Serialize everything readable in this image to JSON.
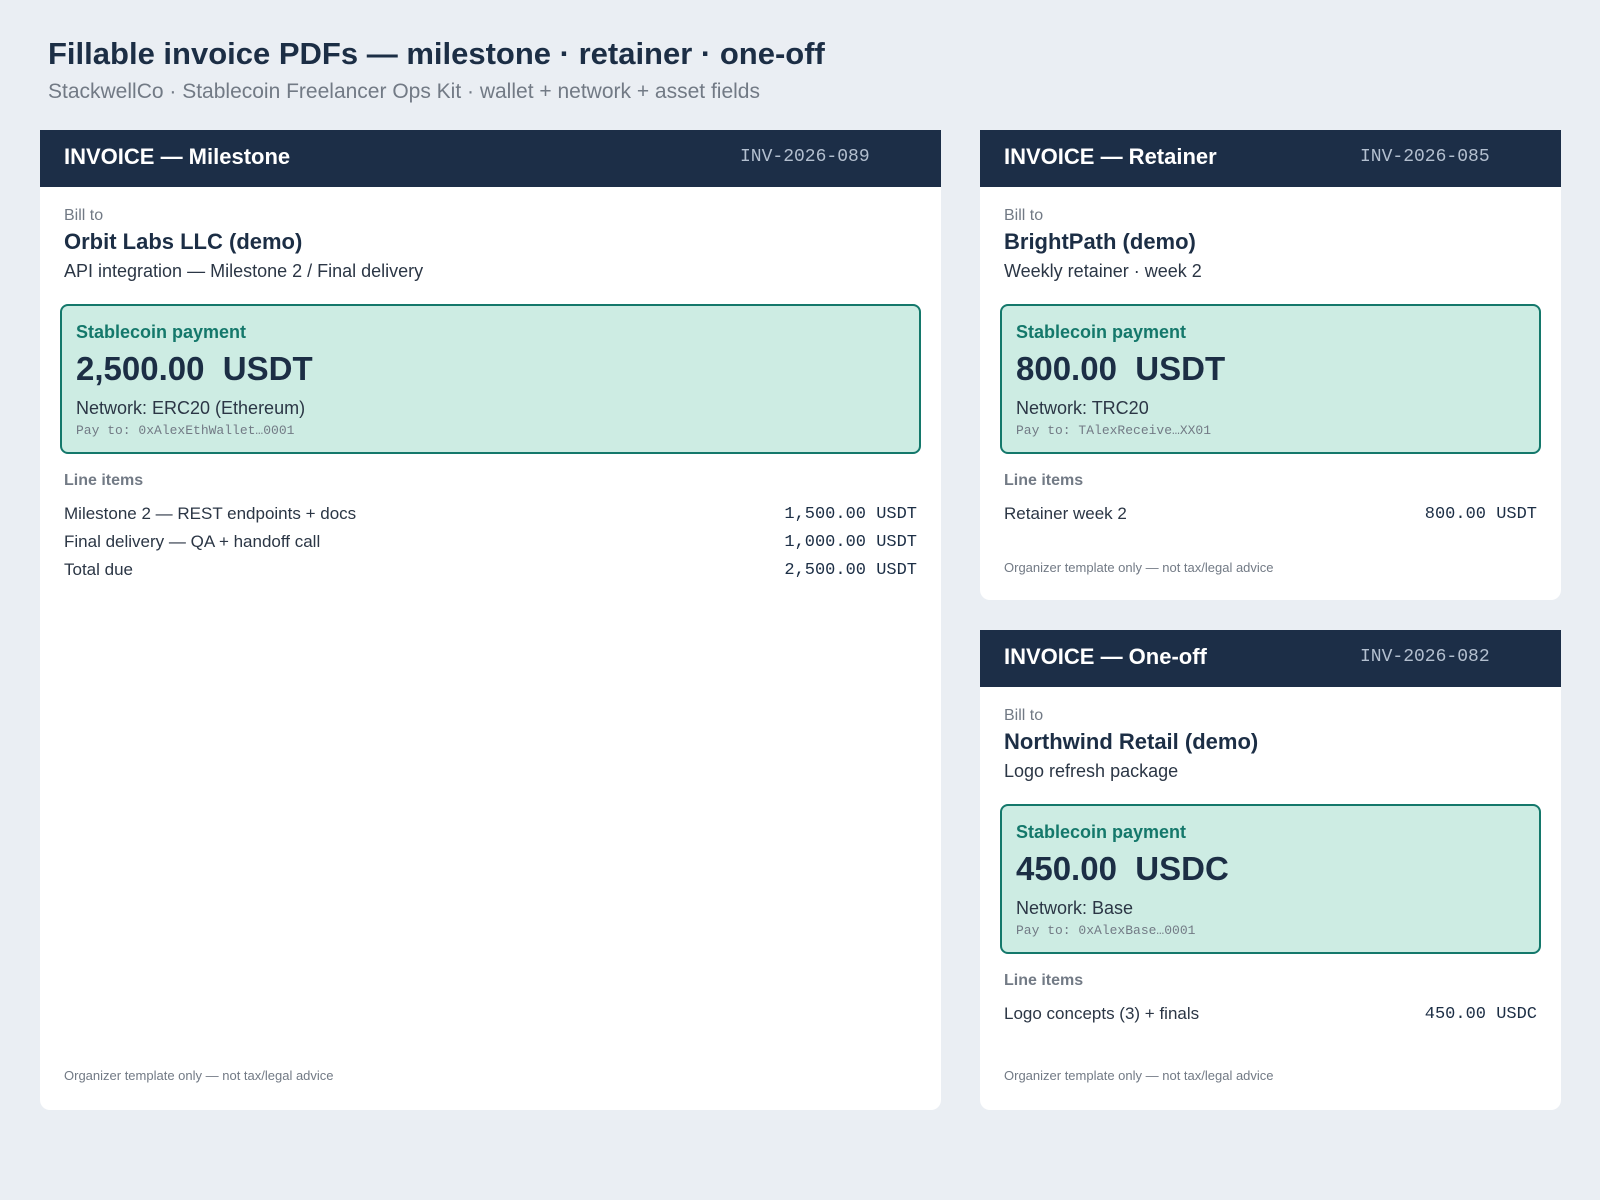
{
  "page": {
    "title": "Fillable invoice PDFs — milestone · retainer · one-off",
    "subtitle": "StackwellCo · Stablecoin Freelancer Ops Kit · wallet + network + asset fields"
  },
  "colors": {
    "background": "#eaeef3",
    "header": "#1c2e47",
    "payment_box": "#cdece3",
    "accent_teal": "#14786b"
  },
  "invoices": [
    {
      "title": "INVOICE — Milestone",
      "number": "INV-2026-089",
      "bill_to_label": "Bill to",
      "client": "Orbit Labs LLC (demo)",
      "description": "API integration — Milestone 2 / Final delivery",
      "payment": {
        "label": "Stablecoin payment",
        "amount": "2,500.00  USDT",
        "network": "Network: ERC20 (Ethereum)",
        "pay_to": "Pay to: 0xAlexEthWallet…0001"
      },
      "items_label": "Line items",
      "items": [
        {
          "description": "Milestone 2 — REST endpoints + docs",
          "amount": "1,500.00 USDT"
        },
        {
          "description": "Final delivery — QA + handoff call",
          "amount": "1,000.00 USDT"
        },
        {
          "description": "Total due",
          "amount": "2,500.00 USDT"
        }
      ],
      "disclaimer": "Organizer template only — not tax/legal advice"
    },
    {
      "title": "INVOICE — Retainer",
      "number": "INV-2026-085",
      "bill_to_label": "Bill to",
      "client": "BrightPath (demo)",
      "description": "Weekly retainer · week 2",
      "payment": {
        "label": "Stablecoin payment",
        "amount": "800.00  USDT",
        "network": "Network: TRC20",
        "pay_to": "Pay to: TAlexReceive…XX01"
      },
      "items_label": "Line items",
      "items": [
        {
          "description": "Retainer week 2",
          "amount": "800.00 USDT"
        }
      ],
      "disclaimer": "Organizer template only — not tax/legal advice"
    },
    {
      "title": "INVOICE — One-off",
      "number": "INV-2026-082",
      "bill_to_label": "Bill to",
      "client": "Northwind Retail (demo)",
      "description": "Logo refresh package",
      "payment": {
        "label": "Stablecoin payment",
        "amount": "450.00  USDC",
        "network": "Network: Base",
        "pay_to": "Pay to: 0xAlexBase…0001"
      },
      "items_label": "Line items",
      "items": [
        {
          "description": "Logo concepts (3) + finals",
          "amount": "450.00 USDC"
        }
      ],
      "disclaimer": "Organizer template only — not tax/legal advice"
    }
  ]
}
